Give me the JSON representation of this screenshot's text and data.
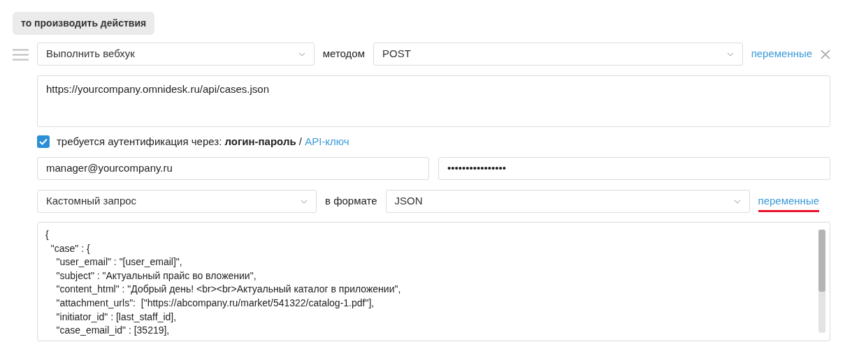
{
  "section_label": "то производить действия",
  "action_row": {
    "action_select": "Выполнить вебхук",
    "method_label": "методом",
    "method_select": "POST",
    "variables_link": {
      "label": "переменные",
      "highlighted": false
    }
  },
  "url_field": {
    "value": "https://yourcompany.omnidesk.ru/api/cases.json"
  },
  "auth": {
    "checked": true,
    "sentence": "требуется аутентификация через: **логин-пароль** / ",
    "api_key_link": "API-ключ"
  },
  "login_field": {
    "value": "manager@yourcompany.ru"
  },
  "password_field": {
    "value": "••••••••••••••••"
  },
  "request_row": {
    "type_select": "Кастомный запрос",
    "format_label": "в формате",
    "format_select": "JSON",
    "variables_link": {
      "label": "переменные",
      "highlighted": true
    }
  },
  "body_lines": [
    "{",
    "  \"case\" : {",
    "    \"user_email\" : \"[user_email]\",",
    "    \"subject\" : \"Актуальный прайс во вложении\",",
    "    \"content_html\" : \"Добрый день! <br><br>Актуальный каталог в приложении\",",
    "    \"attachment_urls\":  [\"https://abcompany.ru/market/541322/catalog-1.pdf\"],",
    "    \"initiator_id\" : [last_staff_id],",
    "    \"case_email_id\" : [35219],"
  ]
}
